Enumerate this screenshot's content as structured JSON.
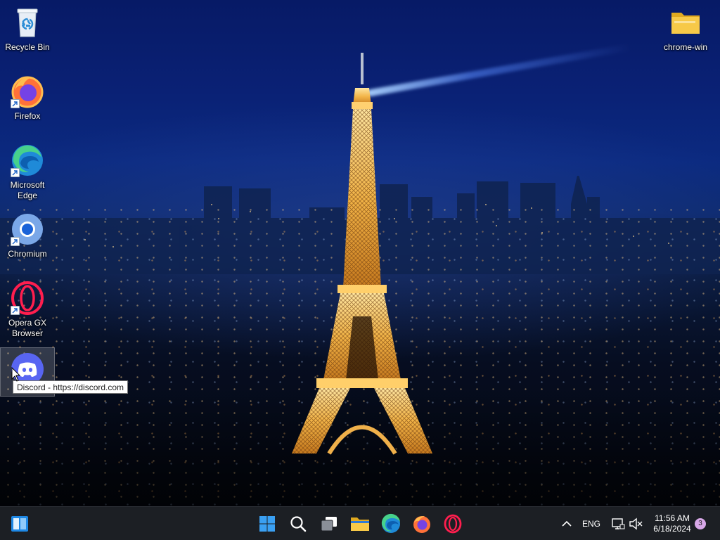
{
  "desktop": {
    "icons": [
      {
        "label": "Recycle Bin",
        "icon": "recycle-bin-icon"
      },
      {
        "label": "Firefox",
        "icon": "firefox-icon"
      },
      {
        "label": "Microsoft Edge",
        "icon": "edge-icon"
      },
      {
        "label": "Chromium",
        "icon": "chromium-icon"
      },
      {
        "label": "Opera GX Browser",
        "icon": "opera-gx-icon"
      },
      {
        "label": "",
        "icon": "discord-icon"
      },
      {
        "label": "chrome-win",
        "icon": "folder-icon"
      }
    ],
    "icon_label_lines": {
      "edge_line1": "Microsoft",
      "edge_line2": "Edge",
      "opera_line1": "Opera GX",
      "opera_line2": "Browser"
    },
    "tooltip": "Discord - https://discord.com"
  },
  "taskbar": {
    "pinned": [
      {
        "name": "start",
        "icon": "windows-logo-icon"
      },
      {
        "name": "search",
        "icon": "search-icon"
      },
      {
        "name": "task-view",
        "icon": "task-view-icon"
      },
      {
        "name": "file-explorer",
        "icon": "folder-icon"
      },
      {
        "name": "edge",
        "icon": "edge-icon"
      },
      {
        "name": "firefox",
        "icon": "firefox-icon"
      },
      {
        "name": "opera",
        "icon": "opera-icon"
      }
    ],
    "tray": {
      "language": "ENG",
      "time": "11:56 AM",
      "date": "6/18/2024",
      "notification_count": "3"
    }
  },
  "colors": {
    "taskbar_bg": "#1c1f24",
    "tooltip_bg": "#ffffff",
    "sky_top": "#071a66"
  }
}
